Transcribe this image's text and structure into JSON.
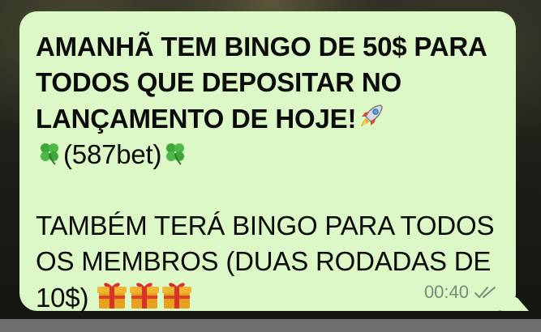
{
  "message": {
    "line1": "AMANHÃ TEM BINGO DE 50$ PARA",
    "line2": "TODOS QUE DEPOSITAR NO",
    "line3": "LANÇAMENTO DE HOJE!",
    "line4": "(587bet)",
    "line5": "TAMBÉM TERÁ BINGO PARA TODOS",
    "line6": "OS MEMBROS (DUAS RODADAS DE",
    "line7": "10$)",
    "time": "00:40",
    "status_icon": "double-check-icon"
  },
  "emojis": {
    "after_line3": "rocket-icon",
    "around_line4": "four-leaf-clover-icon",
    "after_line7": "gift-icon"
  },
  "colors": {
    "bubble": "#dcf8c6",
    "timestamp": "#7c8b76",
    "text": "#0b0b0b"
  }
}
